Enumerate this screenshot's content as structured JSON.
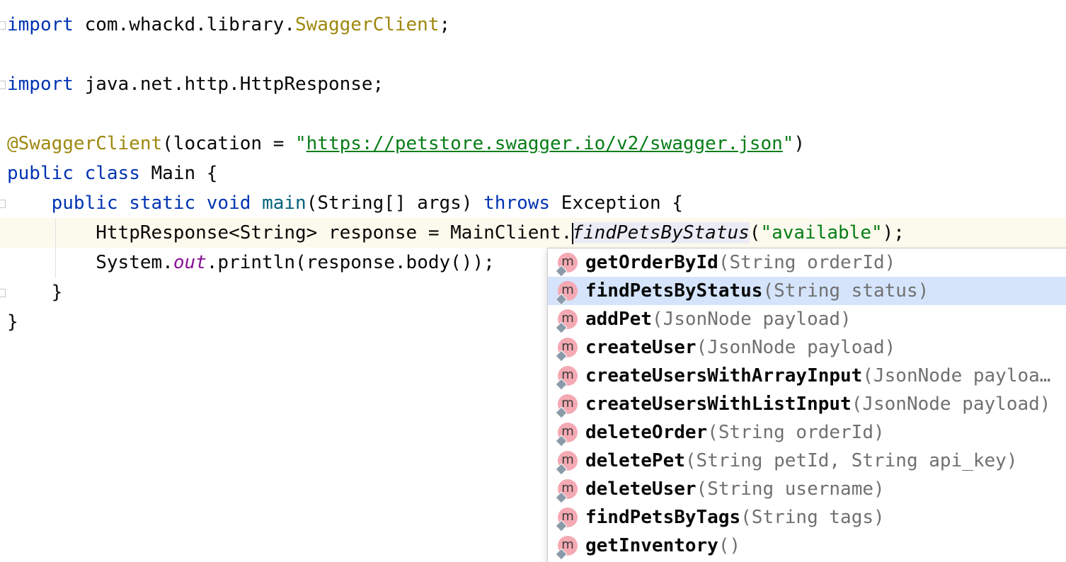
{
  "code": {
    "line1": {
      "kw": "import",
      "pkg": " com.whackd.library.",
      "cls": "SwaggerClient",
      "end": ";"
    },
    "line2": {
      "kw": "import",
      "rest": " java.net.http.HttpResponse;"
    },
    "line3": {
      "ann": "@SwaggerClient",
      "open": "(location = ",
      "q1": "\"",
      "url": "https://petstore.swagger.io/v2/swagger.json",
      "q2": "\"",
      "close": ")"
    },
    "line4": {
      "kw1": "public",
      "kw2": "class",
      "rest": " Main {"
    },
    "line5": {
      "kw1": "public",
      "kw2": "static",
      "kw3": "void",
      "fn": "main",
      "args": "(String[] args) ",
      "kw4": "throws",
      "rest": " Exception {"
    },
    "line6": {
      "pre": "HttpResponse<String> response = MainClient.",
      "call": "findPetsByStatus",
      "open": "(",
      "arg": "\"available\"",
      "close": ");"
    },
    "line7": {
      "pre": "System.",
      "fld": "out",
      "rest": ".println(response.body());"
    },
    "line8": "}",
    "line9": "}"
  },
  "completion": {
    "icon_letter": "m",
    "selected_index": 1,
    "items": [
      {
        "name": "getOrderById",
        "sig": "(String orderId)"
      },
      {
        "name": "findPetsByStatus",
        "sig": "(String status)"
      },
      {
        "name": "addPet",
        "sig": "(JsonNode payload)"
      },
      {
        "name": "createUser",
        "sig": "(JsonNode payload)"
      },
      {
        "name": "createUsersWithArrayInput",
        "sig": "(JsonNode payloa…"
      },
      {
        "name": "createUsersWithListInput",
        "sig": "(JsonNode payload)"
      },
      {
        "name": "deleteOrder",
        "sig": "(String orderId)"
      },
      {
        "name": "deletePet",
        "sig": "(String petId, String api_key)"
      },
      {
        "name": "deleteUser",
        "sig": "(String username)"
      },
      {
        "name": "findPetsByTags",
        "sig": "(String tags)"
      },
      {
        "name": "getInventory",
        "sig": "()"
      }
    ]
  }
}
